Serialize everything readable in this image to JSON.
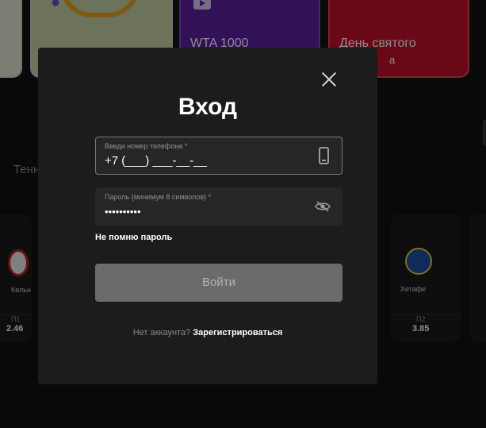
{
  "promos": {
    "card_purple_title": "WTA 1000",
    "card_purple_big": "1000",
    "card_red_title": "День святого",
    "card_red_sub": "а"
  },
  "sport_tab": "Тенн",
  "matches": {
    "left_team": "Кельн",
    "left_odds_label": "П1",
    "left_odds_value": "2.46",
    "right_team": "Хетафе",
    "right_odds_label": "П2",
    "right_odds_value": "3.85"
  },
  "modal": {
    "title": "Вход",
    "phone": {
      "label": "Введи номер телефона *",
      "value": "+7 (___) ___-__-__"
    },
    "password": {
      "label": "Пароль (минимум 8 символов) *",
      "value": "••••••••••"
    },
    "forgot_password": "Не помню пароль",
    "login_button": "Войти",
    "no_account": "Нет аккаунта?",
    "register_link": "Зарегистрироваться"
  },
  "icons": {
    "close": "close-icon",
    "phone": "phone-icon",
    "eye": "eye-off-icon"
  },
  "colors": {
    "modal_bg": "#1c1c1c",
    "button_disabled": "#6b6b6b",
    "promo_purple": "#5b1fa3",
    "promo_red": "#c4102d"
  }
}
